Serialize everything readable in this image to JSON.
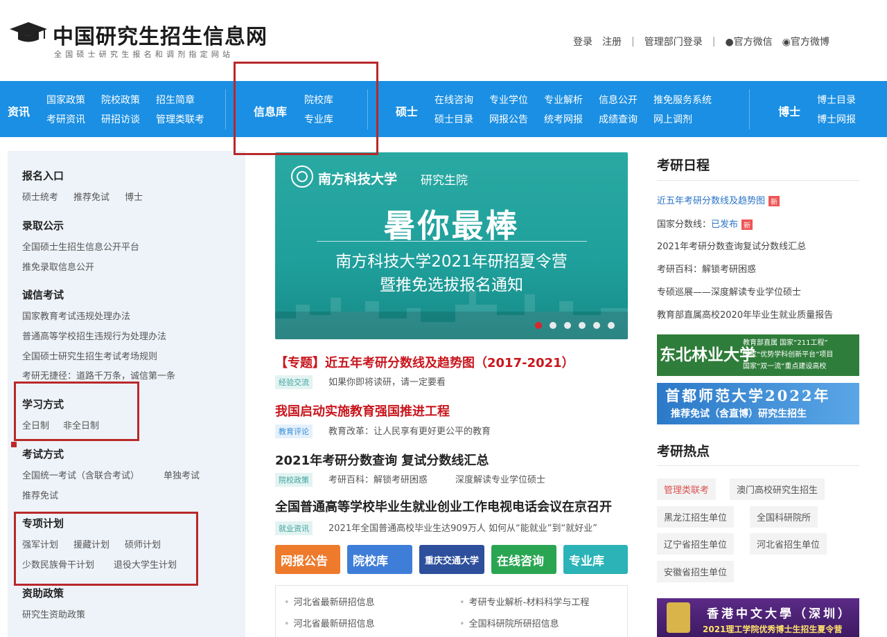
{
  "header": {
    "title": "中国研究生招生信息网",
    "subtitle": "全国硕士研究生报名和调剂指定网站",
    "links": [
      "登录",
      "注册",
      "管理部门登录",
      "官方微信",
      "官方微博"
    ]
  },
  "nav": {
    "sections": [
      "资讯",
      "信息库",
      "硕士",
      "博士"
    ],
    "zixun": [
      "国家政策",
      "院校政策",
      "招生简章",
      "考研资讯",
      "研招访谈",
      "管理类联考"
    ],
    "xinxiku": [
      "院校库",
      "专业库"
    ],
    "shuoshi": [
      "在线咨询",
      "专业学位",
      "专业解析",
      "信息公开",
      "推免服务系统",
      "硕士目录",
      "网报公告",
      "统考网报",
      "成绩查询",
      "网上调剂"
    ],
    "boshi": [
      "博士目录",
      "博士网报"
    ]
  },
  "left": {
    "baoming": {
      "title": "报名入口",
      "items": [
        "硕士统考",
        "推荐免试",
        "博士"
      ]
    },
    "luqu": {
      "title": "录取公示",
      "items": [
        "全国硕士生招生信息公开平台",
        "推免录取信息公开"
      ]
    },
    "chengxin": {
      "title": "诚信考试",
      "items": [
        "国家教育考试违规处理办法",
        "普通高等学校招生违规行为处理办法",
        "全国硕士研究生招生考试考场规则",
        "考研无捷径：道路千万条，诚信第一条"
      ]
    },
    "xuexi": {
      "title": "学习方式",
      "items": [
        "全日制",
        "非全日制"
      ]
    },
    "kaoshi": {
      "title": "考试方式",
      "items": [
        "全国统一考试（含联合考试）",
        "单独考试",
        "推荐免试"
      ]
    },
    "zhuanxiang": {
      "title": "专项计划",
      "items": [
        "强军计划",
        "援藏计划",
        "硕师计划",
        "少数民族骨干计划",
        "退役大学生计划"
      ]
    },
    "zizhu": {
      "title": "资助政策",
      "items": [
        "研究生资助政策"
      ]
    }
  },
  "banner": {
    "school": "南方科技大学",
    "school_sub": "研究生院",
    "headline": "暑你最棒",
    "line1": "南方科技大学2021年研招夏令营",
    "line2": "暨推免选拔报名通知",
    "active_slide": 1,
    "slide_count": 6
  },
  "news": [
    {
      "title": "【专题】近五年考研分数线及趋势图（2017-2021）",
      "color": "#c8161d",
      "tag": "经验交流",
      "subs": [
        "如果你即将读研，请一定要看"
      ]
    },
    {
      "title": "我国启动实施教育强国推进工程",
      "color": "#c8161d",
      "tag": "教育评论",
      "subs": [
        "教育改革：让人民享有更好更公平的教育"
      ]
    },
    {
      "title": "2021年考研分数查询 复试分数线汇总",
      "color": "#222222",
      "tag": "院校政策",
      "subs": [
        "考研百科：解锁考研困惑",
        "深度解读专业学位硕士"
      ]
    },
    {
      "title": "全国普通高等学校毕业生就业创业工作电视电话会议在京召开",
      "color": "#222222",
      "tag": "就业资讯",
      "subs": [
        "2021年全国普通高校毕业生达909万人 如何从“能就业”到“就好业”"
      ]
    }
  ],
  "quick": [
    "网报公告",
    "院校库",
    "重庆交通大学",
    "在线咨询",
    "专业库"
  ],
  "bottom_list": [
    "河北省最新研招信息",
    "考研专业解析-材料科学与工程",
    "河北省最新研招信息",
    "全国科研院所研招信息"
  ],
  "right": {
    "schedule_title": "考研日程",
    "schedule": [
      "近五年考研分数线及趋势图",
      "国家分数线：",
      "已发布",
      "2021年考研分数查询复试分数线汇总",
      "考研百科：解锁考研困惑",
      "专硕巡展——深度解读专业学位硕士",
      "教育部直属高校2020年毕业生就业质量报告"
    ],
    "new_badge": "新",
    "ad1": {
      "name": "东北林业大学",
      "lines": [
        "教育部直属 国家“211工程”",
        "国家“优势学科创新平台”项目",
        "国家“双一流”重点建设高校"
      ]
    },
    "ad2": {
      "name": "首都师范大学2022年",
      "sub": "推荐免试（含直博）研究生招生"
    },
    "hot_title": "考研热点",
    "hot": [
      "管理类联考",
      "澳门高校研究生招生",
      "黑龙江招生单位",
      "全国科研院所",
      "辽宁省招生单位",
      "河北省招生单位",
      "安徽省招生单位"
    ],
    "ad3": {
      "name": "香港中文大學（深圳）",
      "sub": "2021理工学院优秀博士生招生夏令营"
    }
  }
}
